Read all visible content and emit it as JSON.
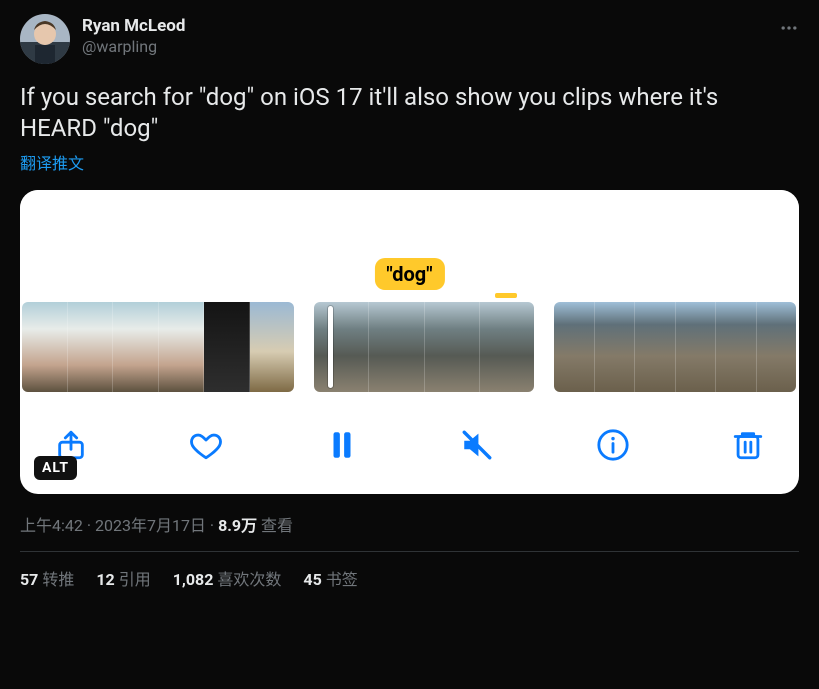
{
  "author": {
    "display_name": "Ryan McLeod",
    "handle": "@warpling"
  },
  "tweet": {
    "text": "If you search for \"dog\" on iOS 17 it'll also show you clips where it's HEARD \"dog\"",
    "translate_label": "翻译推文"
  },
  "media": {
    "bubble_text": "\"dog\"",
    "alt_badge": "ALT"
  },
  "meta": {
    "time": "上午4:42",
    "date": "2023年7月17日",
    "views_count": "8.9万",
    "views_label": "查看"
  },
  "stats": {
    "retweets_count": "57",
    "retweets_label": "转推",
    "quotes_count": "12",
    "quotes_label": "引用",
    "likes_count": "1,082",
    "likes_label": "喜欢次数",
    "bookmarks_count": "45",
    "bookmarks_label": "书签"
  }
}
